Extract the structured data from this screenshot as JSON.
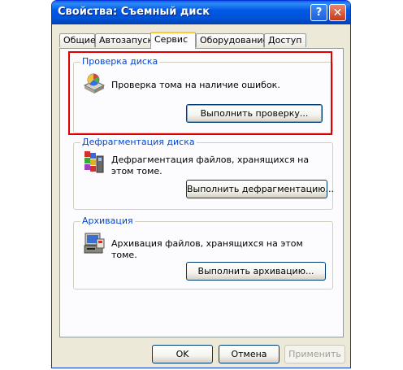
{
  "window": {
    "title": "Свойства: Съемный диск",
    "help_label": "?",
    "close_label": "✕"
  },
  "tabs": [
    {
      "label": "Общие"
    },
    {
      "label": "Автозапуск"
    },
    {
      "label": "Сервис"
    },
    {
      "label": "Оборудование"
    },
    {
      "label": "Доступ"
    }
  ],
  "active_tab": "Сервис",
  "groups": {
    "check": {
      "title": "Проверка диска",
      "description": "Проверка тома на наличие ошибок.",
      "button_label": "Выполнить проверку...",
      "icon": "disk-check-icon"
    },
    "defrag": {
      "title": "Дефрагментация диска",
      "description": "Дефрагментация файлов, хранящихся на этом томе.",
      "button_label": "Выполнить дефрагментацию...",
      "icon": "defrag-icon"
    },
    "backup": {
      "title": "Архивация",
      "description": "Архивация файлов, хранящихся на этом томе.",
      "button_label": "Выполнить архивацию...",
      "icon": "backup-icon"
    }
  },
  "footer": {
    "ok_label": "OK",
    "cancel_label": "Отмена",
    "apply_label": "Применить"
  },
  "colors": {
    "titlebar": "#0058e6",
    "group_title": "#0046d5",
    "highlight": "#e00000",
    "active_tab_accent": "#ffc83c"
  }
}
